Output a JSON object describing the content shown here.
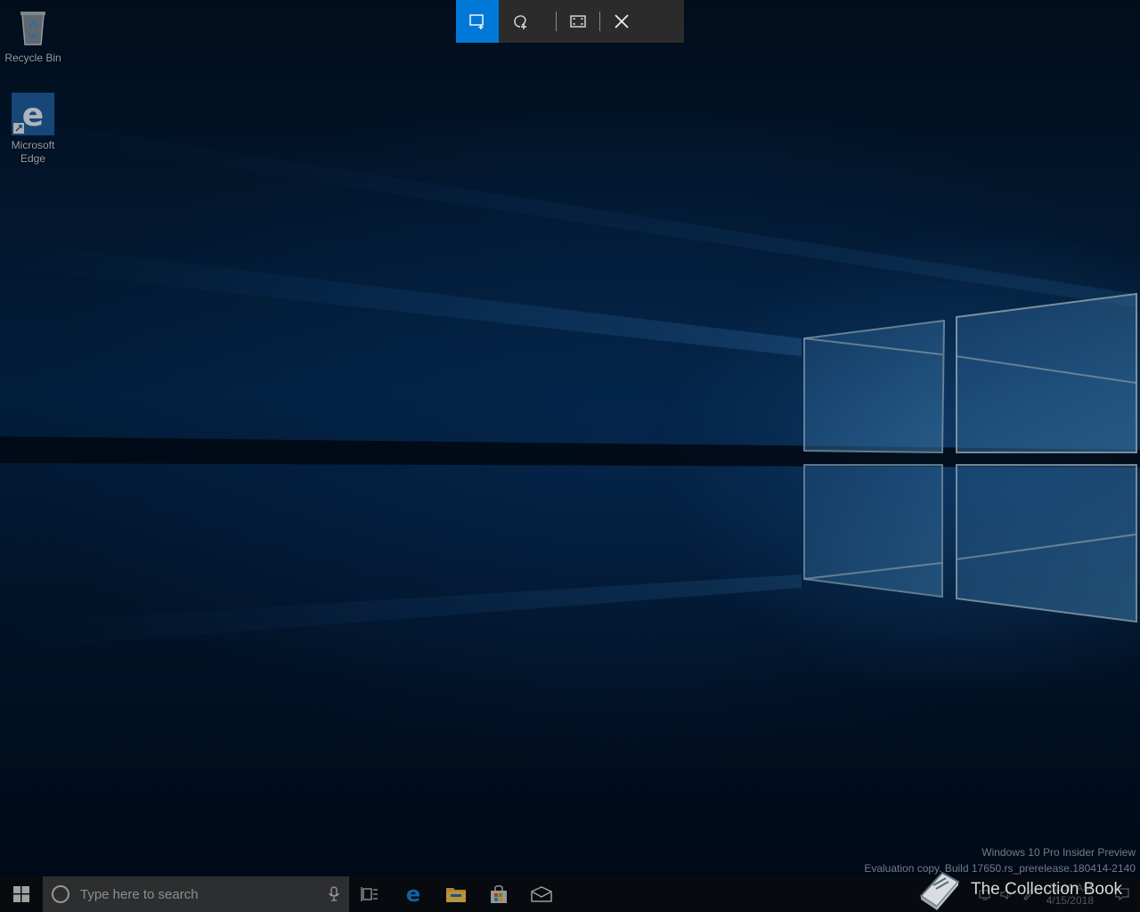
{
  "desktop": {
    "icons": [
      {
        "label": "Recycle Bin",
        "icon": "recycle-bin-icon"
      },
      {
        "label": "Microsoft Edge",
        "icon": "edge-icon"
      }
    ]
  },
  "snip_toolbar": {
    "buttons": [
      {
        "icon": "rectangular-snip-icon",
        "active": true
      },
      {
        "icon": "freeform-snip-icon",
        "active": false
      },
      {
        "icon": "fullscreen-snip-icon",
        "active": false
      },
      {
        "icon": "close-icon",
        "active": false
      }
    ],
    "accent": "#0078d7"
  },
  "watermark": {
    "line1": "Windows 10 Pro Insider Preview",
    "line2": "Evaluation copy. Build 17650.rs_prerelease.180414-2140"
  },
  "taskbar": {
    "search_placeholder": "Type here to search",
    "apps": [
      "task-view-icon",
      "edge-icon",
      "file-explorer-icon",
      "store-icon",
      "mail-icon"
    ],
    "clock": {
      "time": "11:00 AM",
      "date": "4/15/2018"
    }
  },
  "brand": {
    "text": "The Collection Book",
    "icon": "book-icon"
  }
}
